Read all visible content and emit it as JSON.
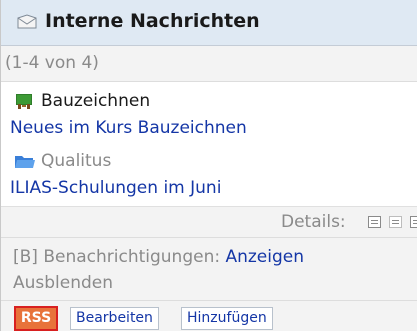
{
  "header": {
    "title": "Interne Nachrichten",
    "icon": "mail-icon"
  },
  "count_text": "(1-4 von 4)",
  "items": [
    {
      "source": "Bauzeichnen",
      "source_icon": "course-icon",
      "link": "Neues im Kurs Bauzeichnen"
    },
    {
      "source": "Qualitus",
      "source_icon": "folder-icon",
      "link": "ILIAS-Schulungen im Juni"
    }
  ],
  "details": {
    "label": "Details:",
    "icons": [
      "view-compact-icon",
      "view-medium-icon",
      "view-full-icon"
    ]
  },
  "notification": {
    "prefix": "[B] Benachrichtigungen: ",
    "show_label": "Anzeigen",
    "hide_label": "Ausblenden"
  },
  "buttons": {
    "rss": "RSS",
    "edit": "Bearbeiten",
    "add": "Hinzufügen"
  },
  "colors": {
    "header_bg": "#dfe9f3",
    "link": "#1436a6",
    "rss_bg": "#e8733a",
    "rss_border": "#d82020"
  }
}
